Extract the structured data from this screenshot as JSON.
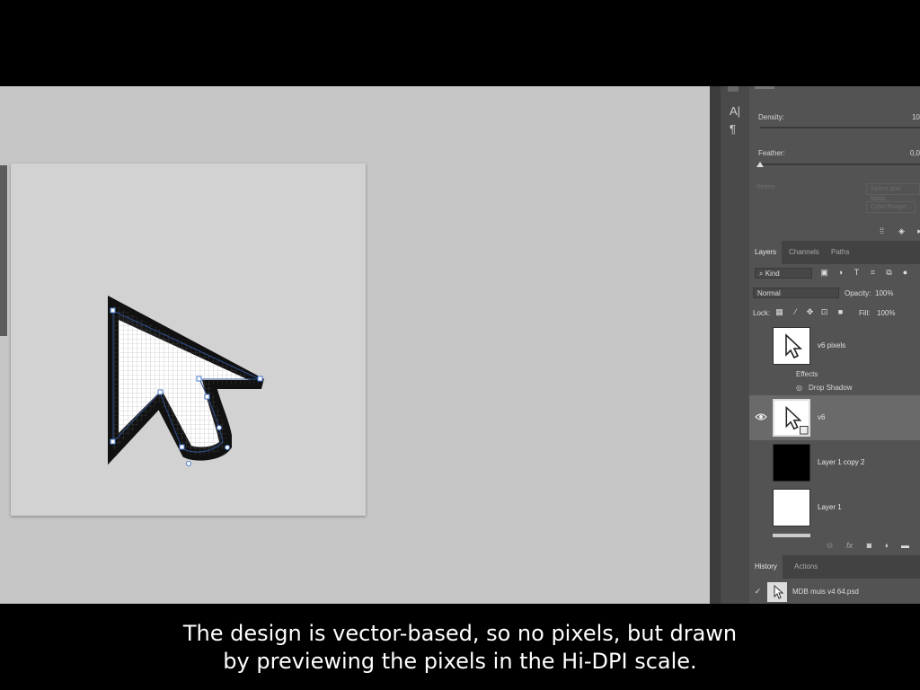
{
  "subtitle": {
    "line1": "The design is vector-based, so no pixels, but drawn",
    "line2": "by previewing the pixels in the Hi-DPI scale."
  },
  "colors": {
    "workspace_bg": "#c6c6c6",
    "panel_bg": "#535353",
    "selected_layer_bg": "#6a6a6a",
    "path_anchor_color": "#4a7bd0"
  },
  "toolstrip": {
    "icons": [
      "text-icon",
      "paragraph-icon"
    ],
    "glyphs": [
      "A|",
      "¶"
    ]
  },
  "properties": {
    "density_label": "Density:",
    "density_value": "10",
    "feather_label": "Feather:",
    "feather_value": "0,0",
    "refine_label": "Refine:",
    "select_mask_button": "Select and Mask...",
    "color_range_button": "Color Range..."
  },
  "layers_panel": {
    "tabs": [
      "Layers",
      "Channels",
      "Paths"
    ],
    "active_tab": "Layers",
    "filter_kind": "Kind",
    "blend_mode": "Normal",
    "opacity_label": "Opacity:",
    "opacity_value": "100%",
    "lock_label": "Lock:",
    "fill_label": "Fill:",
    "fill_value": "100%",
    "layers": [
      {
        "name": "v6 pixels",
        "thumb": "cursor",
        "visible": false,
        "selected": false
      },
      {
        "name": "v6",
        "thumb": "cursor-smart",
        "visible": true,
        "selected": true
      },
      {
        "name": "Layer 1 copy 2",
        "thumb": "black",
        "visible": false,
        "selected": false
      },
      {
        "name": "Layer 1",
        "thumb": "white",
        "visible": false,
        "selected": false
      }
    ],
    "effects": {
      "label": "Effects",
      "item": "Drop Shadow"
    }
  },
  "history_panel": {
    "tabs": [
      "History",
      "Actions"
    ],
    "active_tab": "History",
    "item": "MDB muis v4 64.psd"
  }
}
